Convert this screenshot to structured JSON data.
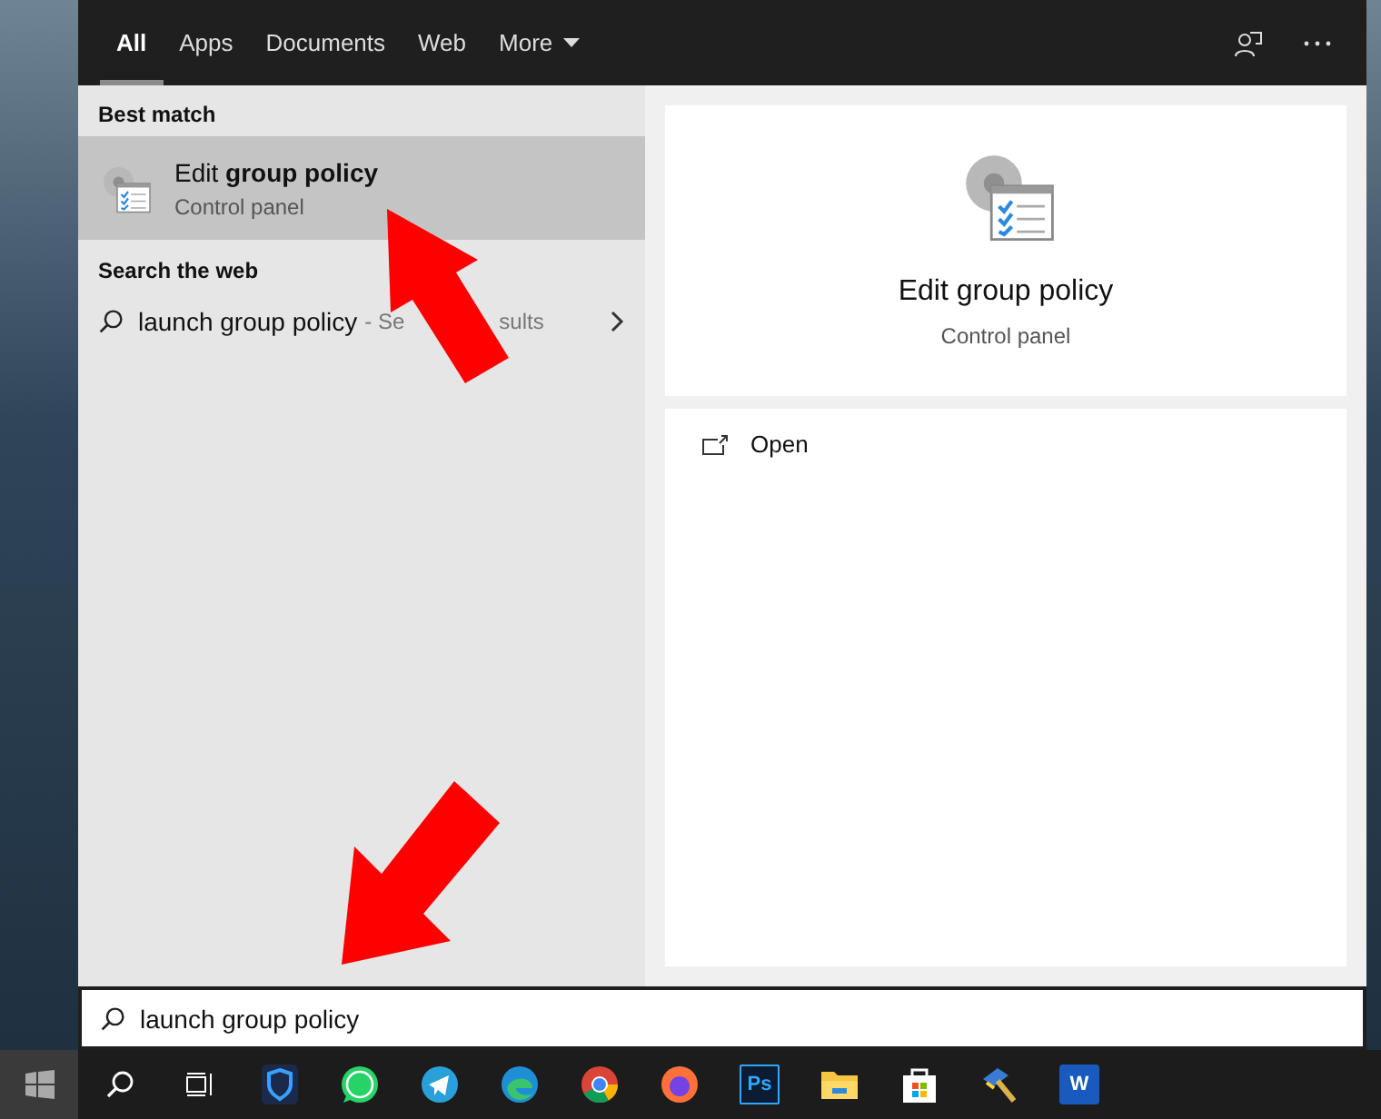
{
  "tabs": [
    {
      "label": "All",
      "selected": true
    },
    {
      "label": "Apps",
      "selected": false
    },
    {
      "label": "Documents",
      "selected": false
    },
    {
      "label": "Web",
      "selected": false
    },
    {
      "label": "More",
      "selected": false,
      "dropdown": true
    }
  ],
  "results": {
    "best_match_heading": "Best match",
    "best_match": {
      "title_start": "Edit ",
      "title_bold": "group policy",
      "subtitle": "Control panel",
      "selected": true
    },
    "web_heading": "Search the web",
    "web_result": {
      "query": "launch group policy",
      "hint_start": "- Se",
      "hint_end": "sults"
    }
  },
  "preview": {
    "title": "Edit group policy",
    "subtitle": "Control panel",
    "actions": [
      {
        "label": "Open"
      }
    ]
  },
  "search": {
    "value": "launch group policy"
  },
  "taskbar": [
    {
      "kind": "search"
    },
    {
      "kind": "taskview"
    },
    {
      "kind": "shield"
    },
    {
      "kind": "whatsapp"
    },
    {
      "kind": "telegram"
    },
    {
      "kind": "edge"
    },
    {
      "kind": "chrome"
    },
    {
      "kind": "firefox"
    },
    {
      "kind": "photoshop",
      "label": "Ps"
    },
    {
      "kind": "explorer"
    },
    {
      "kind": "store"
    },
    {
      "kind": "tool"
    },
    {
      "kind": "word",
      "label": "W"
    }
  ]
}
